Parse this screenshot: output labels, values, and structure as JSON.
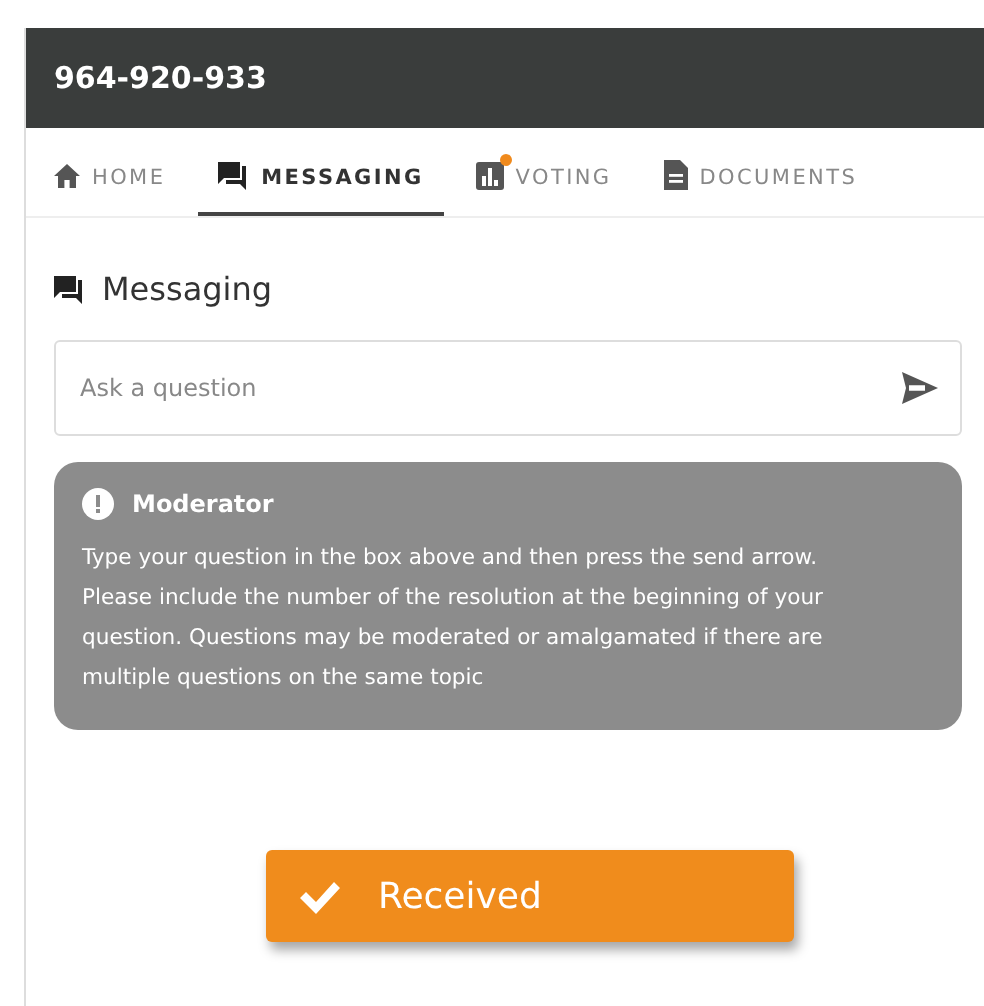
{
  "header": {
    "title": "964-920-933"
  },
  "tabs": [
    {
      "kind": "home",
      "label": "HOME",
      "selected": false,
      "notification": false
    },
    {
      "kind": "messaging",
      "label": "MESSAGING",
      "selected": true,
      "notification": false
    },
    {
      "kind": "voting",
      "label": "VOTING",
      "selected": false,
      "notification": true
    },
    {
      "kind": "documents",
      "label": "DOCUMENTS",
      "selected": false,
      "notification": false
    }
  ],
  "section": {
    "title": "Messaging"
  },
  "question_field": {
    "placeholder": "Ask a question"
  },
  "notice": {
    "title": "Moderator",
    "body": "Type your question in the box above and then press the send arrow. Please include the number of the resolution at the beginning of your question. Questions may be moderated or amalgamated if there are multiple questions on the same topic"
  },
  "toast": {
    "label": "Received"
  }
}
